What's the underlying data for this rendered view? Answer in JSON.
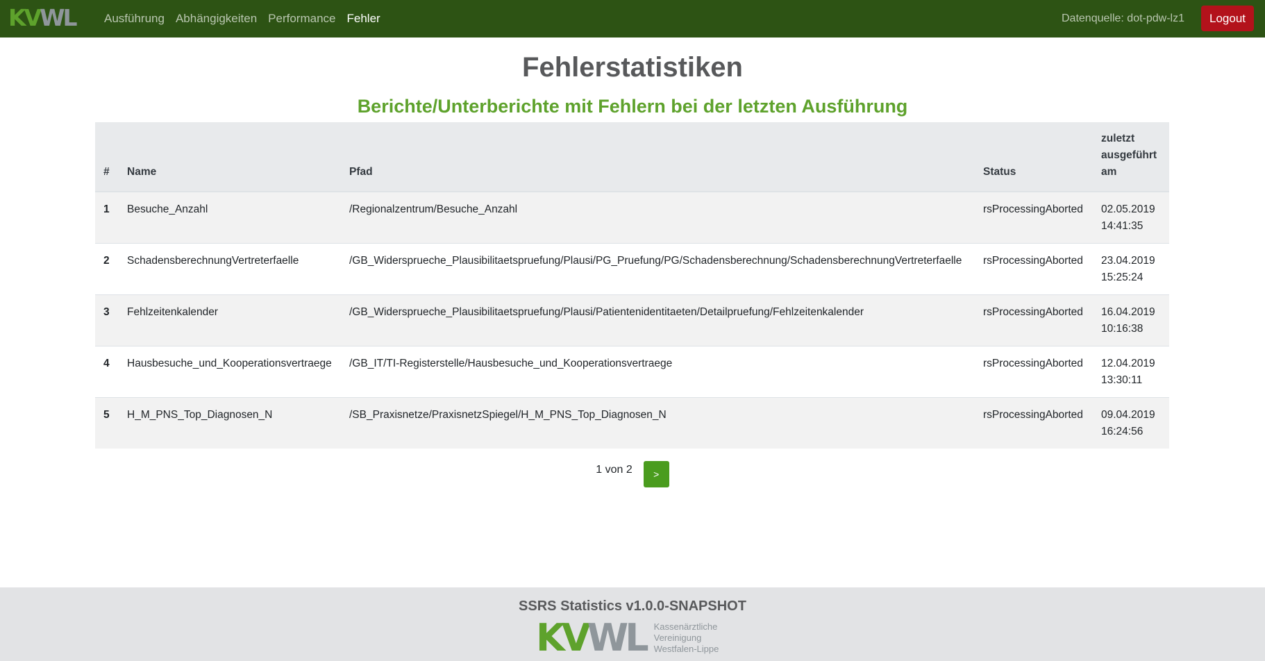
{
  "brand": {
    "logo_kv": "KV",
    "logo_wl": "WL"
  },
  "nav": {
    "items": [
      {
        "label": "Ausführung"
      },
      {
        "label": "Abhängigkeiten"
      },
      {
        "label": "Performance"
      },
      {
        "label": "Fehler",
        "active": true
      }
    ],
    "datasource": "Datenquelle: dot-pdw-lz1",
    "logout_label": "Logout"
  },
  "page": {
    "title": "Fehlerstatistiken",
    "subtitle": "Berichte/Unterberichte mit Fehlern bei der letzten Ausführung"
  },
  "table": {
    "headers": {
      "idx": "#",
      "name": "Name",
      "path": "Pfad",
      "status": "Status",
      "date_line1": "zuletzt",
      "date_line2": "ausgeführt",
      "date_line3": "am"
    },
    "rows": [
      {
        "idx": "1",
        "name": "Besuche_Anzahl",
        "path": "/Regionalzentrum/Besuche_Anzahl",
        "status": "rsProcessingAborted",
        "date": "02.05.2019",
        "time": "14:41:35"
      },
      {
        "idx": "2",
        "name": "SchadensberechnungVertreterfaelle",
        "path": "/GB_Widersprueche_Plausibilitaetspruefung/Plausi/PG_Pruefung/PG/Schadensberechnung/SchadensberechnungVertreterfaelle",
        "status": "rsProcessingAborted",
        "date": "23.04.2019",
        "time": "15:25:24"
      },
      {
        "idx": "3",
        "name": "Fehlzeitenkalender",
        "path": "/GB_Widersprueche_Plausibilitaetspruefung/Plausi/Patientenidentitaeten/Detailpruefung/Fehlzeitenkalender",
        "status": "rsProcessingAborted",
        "date": "16.04.2019",
        "time": "10:16:38"
      },
      {
        "idx": "4",
        "name": "Hausbesuche_und_Kooperationsvertraege",
        "path": "/GB_IT/TI-Registerstelle/Hausbesuche_und_Kooperationsvertraege",
        "status": "rsProcessingAborted",
        "date": "12.04.2019",
        "time": "13:30:11"
      },
      {
        "idx": "5",
        "name": "H_M_PNS_Top_Diagnosen_N",
        "path": "/SB_Praxisnetze/PraxisnetzSpiegel/H_M_PNS_Top_Diagnosen_N",
        "status": "rsProcessingAborted",
        "date": "09.04.2019",
        "time": "16:24:56"
      }
    ]
  },
  "pagination": {
    "info": "1 von 2",
    "next_label": ">"
  },
  "footer": {
    "title": "SSRS Statistics v1.0.0-SNAPSHOT",
    "logo_kv": "KV",
    "logo_wl": "WL",
    "org_line1": "Kassenärztliche",
    "org_line2": "Vereinigung",
    "org_line3": "Westfalen-Lippe"
  },
  "colors": {
    "navbar": "#2d5314",
    "accent_green": "#5ea22c",
    "logout": "#b3121b",
    "footer": "#e2e3e5"
  }
}
